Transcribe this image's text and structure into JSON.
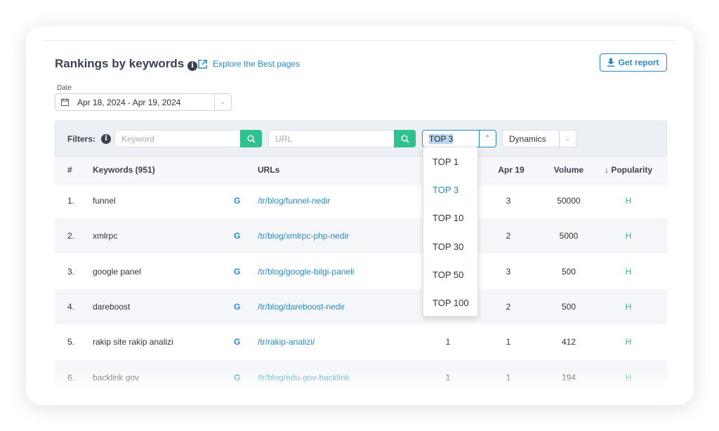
{
  "header": {
    "title": "Rankings by keywords",
    "explore_link": "Explore the Best pages",
    "report_button": "Get report"
  },
  "date": {
    "label": "Date",
    "value": "Apr 18, 2024 - Apr 19, 2024"
  },
  "filters": {
    "label": "Filters:",
    "keyword_placeholder": "Keyword",
    "url_placeholder": "URL",
    "top_value": "TOP 3",
    "dynamics_value": "Dynamics"
  },
  "top_options": [
    "TOP 1",
    "TOP 3",
    "TOP 10",
    "TOP 30",
    "TOP 50",
    "TOP 100"
  ],
  "table": {
    "columns": {
      "num": "#",
      "keywords": "Keywords (951)",
      "urls": "URLs",
      "apr19": "Apr 19",
      "volume": "Volume",
      "popularity": "↓ Popularity"
    },
    "rows": [
      {
        "num": "1.",
        "keyword": "funnel",
        "engine": "G",
        "url": "/tr/blog/funnel-nedir",
        "apr18": "",
        "apr19": "3",
        "volume": "50000",
        "popularity": "H"
      },
      {
        "num": "2.",
        "keyword": "xmlrpc",
        "engine": "G",
        "url": "/tr/blog/xmlrpc-php-nedir",
        "apr18": "",
        "apr19": "2",
        "volume": "5000",
        "popularity": "H"
      },
      {
        "num": "3.",
        "keyword": "google panel",
        "engine": "G",
        "url": "/tr/blog/google-bilgi-paneli",
        "apr18": "",
        "apr19": "3",
        "volume": "500",
        "popularity": "H"
      },
      {
        "num": "4.",
        "keyword": "dareboost",
        "engine": "G",
        "url": "/tr/blog/dareboost-nedir",
        "apr18": "",
        "apr19": "2",
        "volume": "500",
        "popularity": "H"
      },
      {
        "num": "5.",
        "keyword": "rakip site rakip analizi",
        "engine": "G",
        "url": "/tr/rakip-analizi/",
        "apr18": "1",
        "apr19": "1",
        "volume": "412",
        "popularity": "H"
      },
      {
        "num": "6.",
        "keyword": "backlink gov",
        "engine": "G",
        "url": "/tr/blog/edu-gov-backlink",
        "apr18": "1",
        "apr19": "1",
        "volume": "194",
        "popularity": "H"
      }
    ]
  },
  "colors": {
    "accent": "#2b8ac6",
    "green": "#2fc18e",
    "title": "#3a4252"
  }
}
